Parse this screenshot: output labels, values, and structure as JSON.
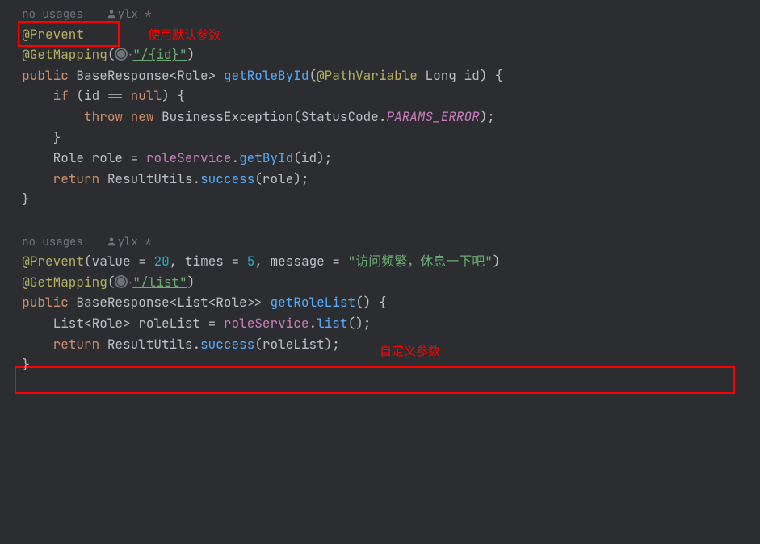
{
  "hints": {
    "no_usages": "no usages",
    "author": "ylx *"
  },
  "annotations_red": {
    "default_params": "使用默认参数",
    "custom_params": "自定义参数"
  },
  "method1": {
    "prevent": "@Prevent",
    "getmapping": "@GetMapping",
    "path": "\"/{id}\"",
    "public": "public",
    "return_type": "BaseResponse",
    "generic": "Role",
    "name": "getRoleById",
    "param_ann": "@PathVariable",
    "param_type": "Long",
    "param_name": "id",
    "if_kw": "if",
    "null_kw": "null",
    "throw_kw": "throw",
    "new_kw": "new",
    "exception": "BusinessException",
    "status_class": "StatusCode",
    "status_const": "PARAMS_ERROR",
    "role_type": "Role",
    "role_var": "role",
    "service": "roleService",
    "getbyid": "getById",
    "return_kw": "return",
    "result_utils": "ResultUtils",
    "success": "success"
  },
  "method2": {
    "prevent": "@Prevent",
    "value_kw": "value",
    "value_num": "20",
    "times_kw": "times",
    "times_num": "5",
    "message_kw": "message",
    "message_str": "\"访问频繁，休息一下吧\"",
    "getmapping": "@GetMapping",
    "path": "\"/list\"",
    "public": "public",
    "return_type": "BaseResponse",
    "list_type": "List",
    "generic": "Role",
    "name": "getRoleList",
    "rolelist_var": "roleList",
    "service": "roleService",
    "list_method": "list",
    "return_kw": "return",
    "result_utils": "ResultUtils",
    "success": "success"
  }
}
